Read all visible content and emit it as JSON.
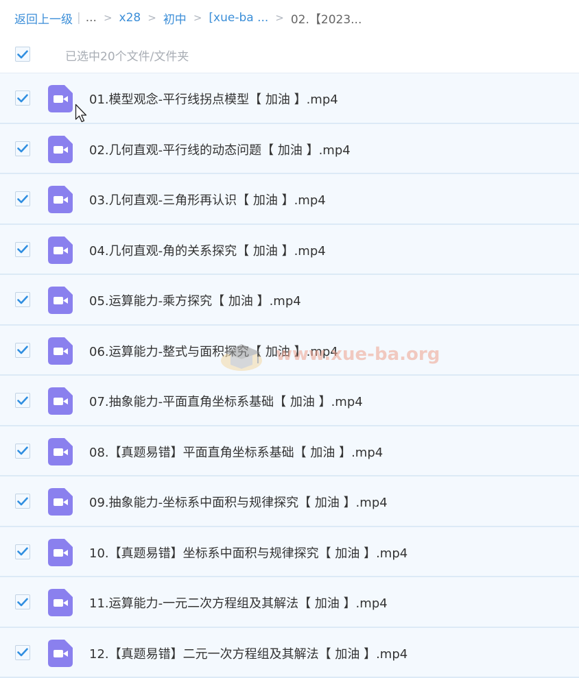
{
  "breadcrumb": {
    "back": "返回上一级",
    "separator": "|",
    "ellipsis": "...",
    "arrow": ">",
    "links": [
      "x28",
      "初中",
      "[xue-ba ..."
    ],
    "current": "02.【2023..."
  },
  "selection": {
    "count_text": "已选中20个文件/文件夹"
  },
  "files": [
    {
      "name": "01.模型观念-平行线拐点模型【 加油 】.mp4"
    },
    {
      "name": "02.几何直观-平行线的动态问题【 加油 】.mp4"
    },
    {
      "name": "03.几何直观-三角形再认识【 加油 】.mp4"
    },
    {
      "name": "04.几何直观-角的关系探究【 加油 】.mp4"
    },
    {
      "name": "05.运算能力-乘方探究【 加油 】.mp4"
    },
    {
      "name": "06.运算能力-整式与面积探究【 加油 】.mp4"
    },
    {
      "name": "07.抽象能力-平面直角坐标系基础【 加油 】.mp4"
    },
    {
      "name": "08.【真题易错】平面直角坐标系基础【 加油 】.mp4"
    },
    {
      "name": "09.抽象能力-坐标系中面积与规律探究【 加油 】.mp4"
    },
    {
      "name": "10.【真题易错】坐标系中面积与规律探究【 加油 】.mp4"
    },
    {
      "name": "11.运算能力-一元二次方程组及其解法【 加油 】.mp4"
    },
    {
      "name": "12.【真题易错】二元一次方程组及其解法【 加油 】.mp4"
    }
  ],
  "watermark": {
    "text": "www.xue-ba.org"
  },
  "icons": {
    "checkbox": "checkmark-icon",
    "file": "video-file-icon",
    "cursor": "mouse-pointer-icon"
  },
  "colors": {
    "link": "#3b8ed8",
    "check": "#2f8ee0",
    "video_icon": "#8a80ee",
    "row_bg": "#f4f9fe",
    "row_border": "#dceaf6"
  }
}
